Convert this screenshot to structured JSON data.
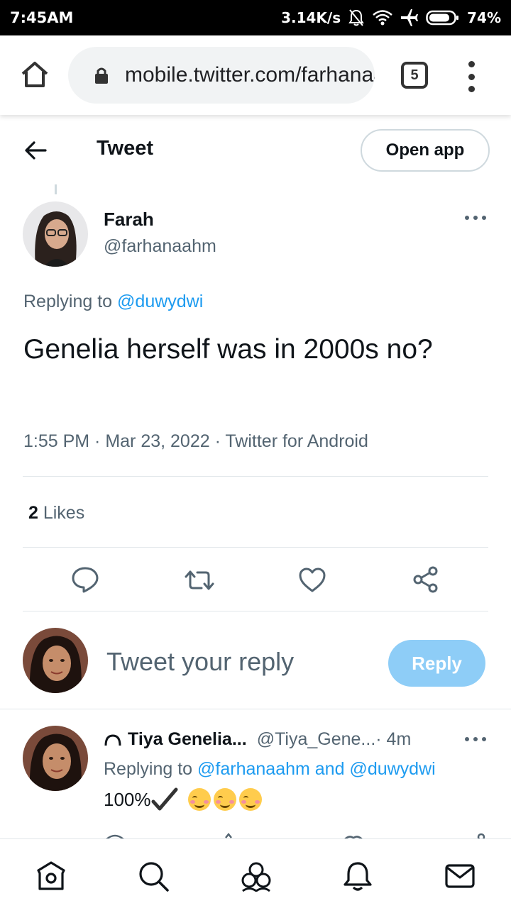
{
  "status_bar": {
    "time": "7:45AM",
    "speed": "3.14K/s",
    "battery": "74%"
  },
  "browser": {
    "url": "mobile.twitter.com/farhanaahm",
    "tab_count": "5"
  },
  "header": {
    "title": "Tweet",
    "open_app": "Open app"
  },
  "tweet": {
    "author_name": "Farah",
    "author_handle": "@farhanaahm",
    "replying_prefix": "Replying to ",
    "replying_to": "@duwydwi",
    "text": "Genelia herself was in 2000s no?",
    "meta": "1:55 PM · Mar 23, 2022 · Twitter for Android",
    "likes_count": "2",
    "likes_label": " Likes"
  },
  "composer": {
    "placeholder": "Tweet your reply",
    "reply_button": "Reply"
  },
  "reply": {
    "name": "Tiya Genelia...",
    "handle": "@Tiya_Gene...",
    "time": " · 4m",
    "replying_prefix": "Replying to ",
    "replying_to": "@farhanaahm and @duwydwi",
    "text": "100%"
  },
  "colors": {
    "accent": "#1d9bf0",
    "reply_button_disabled": "#8ecdf7",
    "secondary_text": "#536471"
  },
  "icons": {
    "status": [
      "dnd-bell-off-icon",
      "wifi-icon",
      "airplane-icon",
      "battery-icon"
    ],
    "actions": [
      "reply-icon",
      "retweet-icon",
      "like-icon",
      "share-icon"
    ],
    "nav": [
      "home-icon",
      "search-icon",
      "communities-icon",
      "notifications-icon",
      "messages-icon"
    ]
  }
}
